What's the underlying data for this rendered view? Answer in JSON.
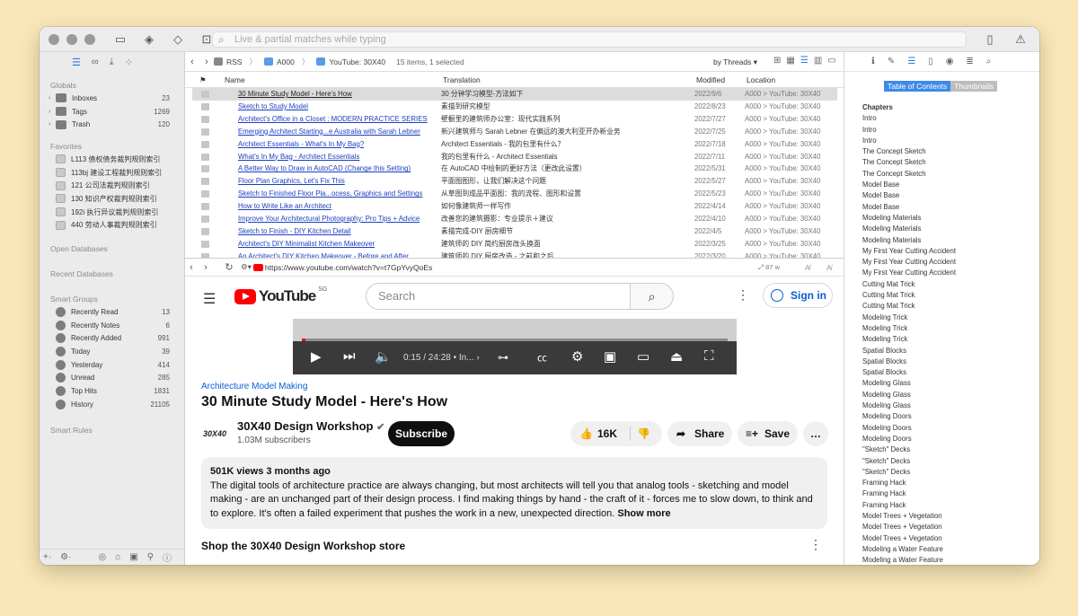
{
  "toolbar": {
    "search_placeholder": "Live & partial matches while typing"
  },
  "sidebar": {
    "globals_title": "Globals",
    "globals": [
      {
        "label": "Inboxes",
        "count": "23"
      },
      {
        "label": "Tags",
        "count": "1269"
      },
      {
        "label": "Trash",
        "count": "120"
      }
    ],
    "favorites_title": "Favorites",
    "favorites": [
      {
        "label": "L113 债权债务裁判规则索引"
      },
      {
        "label": "113bj 建设工程裁判规则索引"
      },
      {
        "label": "121 公司法裁判规则索引"
      },
      {
        "label": "130 知识产权裁判规则索引"
      },
      {
        "label": "192i 执行异议裁判规则索引"
      },
      {
        "label": "440 劳动人事裁判规则索引"
      }
    ],
    "open_databases": "Open Databases",
    "recent_databases": "Recent Databases",
    "smart_groups_title": "Smart Groups",
    "smart_groups": [
      {
        "label": "Recently Read",
        "count": "13"
      },
      {
        "label": "Recently Notes",
        "count": "6"
      },
      {
        "label": "Recently Added",
        "count": "991"
      },
      {
        "label": "Today",
        "count": "39"
      },
      {
        "label": "Yesterday",
        "count": "414"
      },
      {
        "label": "Unread",
        "count": "285"
      },
      {
        "label": "Top Hits",
        "count": "1831"
      },
      {
        "label": "History",
        "count": "21105"
      }
    ],
    "smart_rules": "Smart Rules"
  },
  "navigation": {
    "crumb_1": "RSS",
    "crumb_2": "A000",
    "crumb_3": "YouTube: 30X40",
    "count": "15 items, 1 selected",
    "sort": "by Threads"
  },
  "table": {
    "headers": {
      "name": "Name",
      "translation": "Translation",
      "modified": "Modified",
      "location": "Location"
    },
    "rows": [
      {
        "name": "30 Minute Study Model - Here's How",
        "translation": "30 分钟学习模型-方法如下",
        "modified": "2022/9/6",
        "location": "A000 > YouTube: 30X40"
      },
      {
        "name": "Sketch to Study Model",
        "translation": "素描到研究模型",
        "modified": "2022/8/23",
        "location": "A000 > YouTube: 30X40"
      },
      {
        "name": "Architect's Office in a Closet : MODERN PRACTICE SERIES",
        "translation": "壁橱里的建筑师办公室：现代实践系列",
        "modified": "2022/7/27",
        "location": "A000 > YouTube: 30X40"
      },
      {
        "name": "Emerging Architect Starting...e Australia with Sarah Lebner",
        "translation": "新兴建筑师与 Sarah Lebner 在偏远的澳大利亚开办新业务",
        "modified": "2022/7/25",
        "location": "A000 > YouTube: 30X40"
      },
      {
        "name": "Architect Essentials - What's In My Bag?",
        "translation": "Architect Essentials - 我的包里有什么？",
        "modified": "2022/7/18",
        "location": "A000 > YouTube: 30X40"
      },
      {
        "name": "What's In My Bag - Architect Essentials",
        "translation": "我的包里有什么 - Architect Essentials",
        "modified": "2022/7/11",
        "location": "A000 > YouTube: 30X40"
      },
      {
        "name": "A Better Way to Draw in AutoCAD (Change this Setting)",
        "translation": "在 AutoCAD 中绘制的更好方法（更改此设置）",
        "modified": "2022/5/31",
        "location": "A000 > YouTube: 30X40"
      },
      {
        "name": "Floor Plan Graphics, Let's Fix This",
        "translation": "平面图图形，让我们解决这个问题",
        "modified": "2022/5/27",
        "location": "A000 > YouTube: 30X40"
      },
      {
        "name": "Sketch to Finished Floor Pla...ocess, Graphics and Settings",
        "translation": "从草图到成品平面图：我的流程、图形和设置",
        "modified": "2022/5/23",
        "location": "A000 > YouTube: 30X40"
      },
      {
        "name": "How to Write Like an Architect",
        "translation": "如何像建筑师一样写作",
        "modified": "2022/4/14",
        "location": "A000 > YouTube: 30X40"
      },
      {
        "name": "Improve Your Architectural Photography: Pro Tips + Advice",
        "translation": "改善您的建筑摄影：专业提示＋建议",
        "modified": "2022/4/10",
        "location": "A000 > YouTube: 30X40"
      },
      {
        "name": "Sketch to Finish - DIY Kitchen Detail",
        "translation": "素描完成-DIY 厨房细节",
        "modified": "2022/4/5",
        "location": "A000 > YouTube: 30X40"
      },
      {
        "name": "Architect's DIY Minimalist Kitchen Makeover",
        "translation": "建筑师的 DIY 简约厨房改头换面",
        "modified": "2022/3/25",
        "location": "A000 > YouTube: 30X40"
      },
      {
        "name": "An Architect's DIY Kitchen Makeover - Before and After",
        "translation": "建筑师的 DIY 厨房改造 - 之前和之后",
        "modified": "2022/3/20",
        "location": "A000 > YouTube: 30X40"
      }
    ]
  },
  "web": {
    "url": "https://www.youtube.com/watch?v=t7GpYvyQoEs",
    "zoom": "87 w",
    "font_a": "A",
    "search_placeholder": "Search",
    "logo_word": "YouTube",
    "logo_region": "SG",
    "sign_in": "Sign in",
    "time": "0:15 / 24:28",
    "time_suffix": "• In...",
    "category": "Architecture Model Making",
    "title": "30 Minute Study Model - Here's How",
    "channel_logo": "30X40",
    "channel": "30X40 Design Workshop",
    "subscribers": "1.03M subscribers",
    "subscribe": "Subscribe",
    "likes": "16K",
    "share": "Share",
    "save": "Save",
    "views_line": "501K views  3 months ago",
    "description": "The digital tools of architecture practice are always changing, but most architects will tell you that analog tools - sketching and model making - are an unchanged part of their design process. I find making things by hand - the craft of it - forces me to slow down, to think and to explore. It's often a failed experiment that pushes the work in a new, unexpected direction.",
    "show_more": "Show more",
    "shop": "Shop the 30X40 Design Workshop store"
  },
  "inspector": {
    "tab_toc": "Table of Contents",
    "tab_thumbs": "Thumbnails",
    "chapters_title": "Chapters",
    "chapters": [
      "Intro",
      "Intro",
      "Intro",
      "The Concept Sketch",
      "The Concept Sketch",
      "The Concept Sketch",
      "Model Base",
      "Model Base",
      "Model Base",
      "Modeling Materials",
      "Modeling Materials",
      "Modeling Materials",
      "My First Year Cutting Accident",
      "My First Year Cutting Accident",
      "My First Year Cutting Accident",
      "Cutting Mat Trick",
      "Cutting Mat Trick",
      "Cutting Mat Trick",
      "Modeling Trick",
      "Modeling Trick",
      "Modeling Trick",
      "Spatial Blocks",
      "Spatial Blocks",
      "Spatial Blocks",
      "Modeling Glass",
      "Modeling Glass",
      "Modeling Glass",
      "Modeling Doors",
      "Modeling Doors",
      "Modeling Doors",
      "\"Sketch\" Decks",
      "\"Sketch\" Decks",
      "\"Sketch\" Decks",
      "Framing Hack",
      "Framing Hack",
      "Framing Hack",
      "Model Trees + Vegetation",
      "Model Trees + Vegetation",
      "Model Trees + Vegetation",
      "Modeling a Water Feature",
      "Modeling a Water Feature"
    ]
  }
}
